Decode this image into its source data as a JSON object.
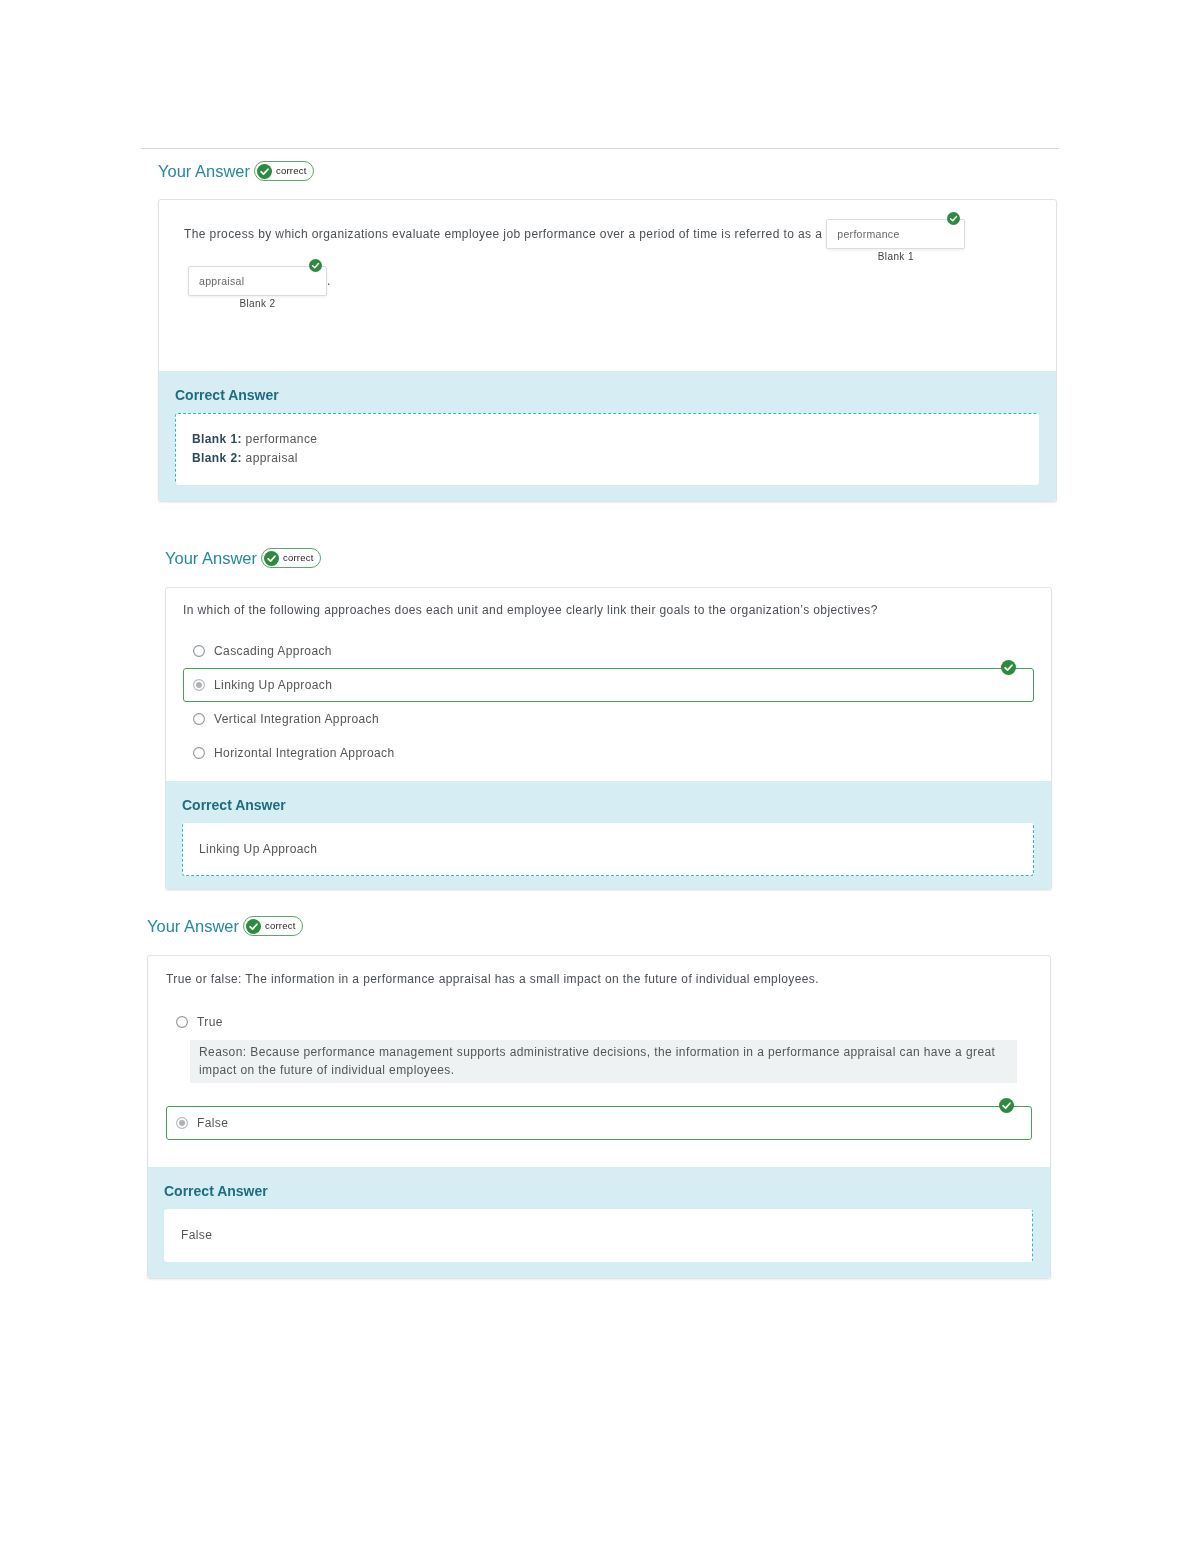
{
  "questions": [
    {
      "kind": "fill_in_blank",
      "heading": "Your Answer",
      "result": "correct",
      "prompt": "The process by which organizations evaluate employee job performance over a period of time is referred to as a",
      "blanks": [
        {
          "value": "performance",
          "label": "Blank 1",
          "correct": true
        },
        {
          "value": "appraisal",
          "label": "Blank 2",
          "correct": true
        }
      ],
      "ending": ".",
      "correct_answer": {
        "title": "Correct Answer",
        "lines": [
          "**Blank 1:** performance",
          "**Blank 2:** appraisal"
        ]
      }
    },
    {
      "kind": "multiple_choice",
      "heading": "Your Answer",
      "result": "correct",
      "prompt": "In which of the following approaches does each unit and employee clearly link their goals to the organization’s objectives?",
      "options": [
        {
          "label": "Cascading Approach",
          "selected": false
        },
        {
          "label": "Linking Up Approach",
          "selected": true
        },
        {
          "label": "Vertical Integration Approach",
          "selected": false
        },
        {
          "label": "Horizontal Integration Approach",
          "selected": false
        }
      ],
      "correct_answer": {
        "title": "Correct Answer",
        "lines": [
          "Linking Up Approach"
        ]
      }
    },
    {
      "kind": "true_false",
      "heading": "Your Answer",
      "result": "correct",
      "prompt": "True or false: The information in a performance appraisal has a small impact on the future of individual employees.",
      "options": [
        {
          "label": "True",
          "selected": false,
          "reason": "Reason: Because performance management supports administrative decisions, the information in a performance appraisal can have a great impact on the future of individual employees."
        },
        {
          "label": "False",
          "selected": true
        }
      ],
      "correct_answer": {
        "title": "Correct Answer",
        "lines": [
          "False"
        ]
      }
    }
  ]
}
